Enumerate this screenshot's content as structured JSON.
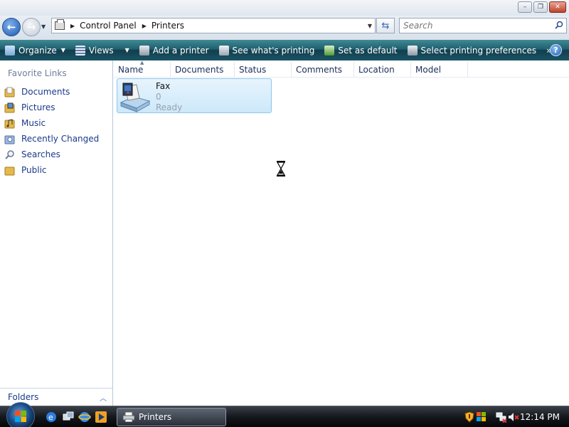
{
  "window": {
    "title_buttons": {
      "minimize": "–",
      "maximize": "❐",
      "close": "✕"
    }
  },
  "nav": {
    "back_icon": "arrow-left-icon",
    "forward_icon": "arrow-right-icon"
  },
  "address": {
    "breadcrumbs": [
      "Control Panel",
      "Printers"
    ]
  },
  "search": {
    "placeholder": "Search"
  },
  "toolbar": {
    "items": [
      "Organize",
      "Views",
      "Add a printer",
      "See what's printing",
      "Set as default",
      "Select printing preferences"
    ],
    "more": "»",
    "help": "?"
  },
  "sidebar": {
    "title": "Favorite Links",
    "items": [
      "Documents",
      "Pictures",
      "Music",
      "Recently Changed",
      "Searches",
      "Public"
    ],
    "folders_label": "Folders"
  },
  "columns": [
    "Name",
    "Documents",
    "Status",
    "Comments",
    "Location",
    "Model"
  ],
  "printer": {
    "name": "Fax",
    "documents": "0",
    "status": "Ready"
  },
  "taskbar": {
    "window_button": "Printers",
    "clock": "12:14 PM"
  },
  "colors": {
    "toolbar": "#1f5f6d",
    "selection": "#cde8fa",
    "link": "#1a3a8a"
  }
}
